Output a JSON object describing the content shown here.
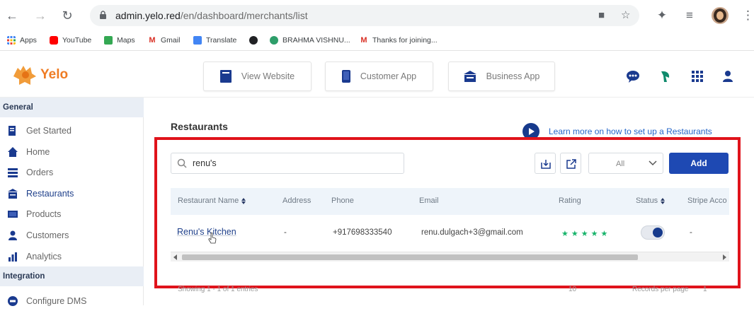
{
  "browser": {
    "url_host": "admin.yelo.red",
    "url_path": "/en/dashboard/merchants/list",
    "bookmarks": [
      {
        "label": "Apps",
        "color": "#4285f4"
      },
      {
        "label": "YouTube",
        "color": "#ff0000"
      },
      {
        "label": "Maps",
        "color": "#34a853"
      },
      {
        "label": "Gmail",
        "color": "#d93025"
      },
      {
        "label": "Translate",
        "color": "#4285f4"
      },
      {
        "label": "",
        "color": "#202124"
      },
      {
        "label": "BRAHMA VISHNU...",
        "color": "#2e9e6a"
      },
      {
        "label": "Thanks for joining...",
        "color": "#d93025"
      }
    ]
  },
  "app": {
    "brand": "Yelo",
    "brand_color": "#ef7c24",
    "header_buttons": {
      "view_website": "View Website",
      "customer_app": "Customer App",
      "business_app": "Business App"
    }
  },
  "sidebar": {
    "general_title": "General",
    "items": [
      {
        "label": "Get Started",
        "icon": "document-edit-icon"
      },
      {
        "label": "Home",
        "icon": "home-icon"
      },
      {
        "label": "Orders",
        "icon": "list-icon"
      },
      {
        "label": "Restaurants",
        "icon": "store-icon"
      },
      {
        "label": "Products",
        "icon": "box-icon"
      },
      {
        "label": "Customers",
        "icon": "user-icon"
      },
      {
        "label": "Analytics",
        "icon": "chart-icon"
      }
    ],
    "integration_title": "Integration",
    "integration_items": [
      {
        "label": "Configure DMS",
        "icon": "settings-icon"
      }
    ]
  },
  "main": {
    "title": "Restaurants",
    "learn_more": "Learn more on how to set up a Restaurants",
    "search_value": "renu's",
    "filter_value": "All",
    "add_label": "Add",
    "table": {
      "headers": {
        "name": "Restaurant Name",
        "address": "Address",
        "phone": "Phone",
        "email": "Email",
        "rating": "Rating",
        "status": "Status",
        "stripe": "Stripe Acco"
      },
      "rows": [
        {
          "name": "Renu's Kitchen",
          "address": "-",
          "phone": "+917698333540",
          "email": "renu.dulgach+3@gmail.com",
          "rating": "★★★★★",
          "status_on": true,
          "stripe": "-"
        }
      ]
    },
    "footer": {
      "showing": "Showing 1 - 1 of 1 entries",
      "per_page_value": "10",
      "records_label": "Records per page",
      "page": "1"
    }
  },
  "colors": {
    "primary": "#1e49b3",
    "highlight": "#e0131b",
    "link": "#2466c9"
  }
}
